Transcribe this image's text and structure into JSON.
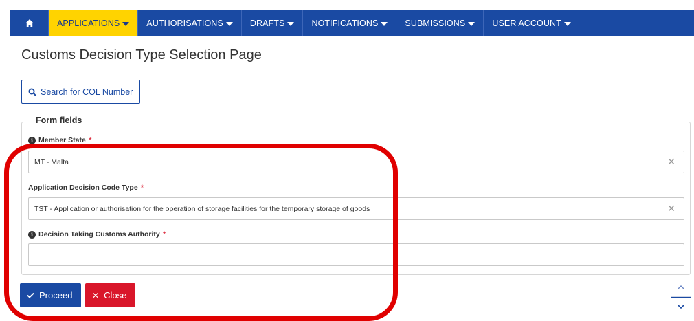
{
  "nav": {
    "home_icon": "home-icon",
    "items": [
      {
        "label": "APPLICATIONS"
      },
      {
        "label": "AUTHORISATIONS"
      },
      {
        "label": "DRAFTS"
      },
      {
        "label": "NOTIFICATIONS"
      },
      {
        "label": "SUBMISSIONS"
      },
      {
        "label": "USER ACCOUNT"
      }
    ],
    "active_color": "#ffd300",
    "bar_color": "#1a4aa3"
  },
  "page": {
    "title": "Customs Decision Type Selection Page"
  },
  "search": {
    "label": "Search for COL Number"
  },
  "form": {
    "legend": "Form fields",
    "member_state": {
      "label": "Member State",
      "required": "*",
      "value": "MT - Malta"
    },
    "decision_code_type": {
      "label": "Application Decision Code Type",
      "required": "*",
      "value": "TST - Application or authorisation for the operation of storage facilities for the temporary storage of goods"
    },
    "customs_authority": {
      "label": "Decision Taking Customs Authority",
      "required": "*",
      "value": ""
    }
  },
  "actions": {
    "proceed_label": "Proceed",
    "close_label": "Close"
  },
  "annotation": {
    "color": "#e00000"
  }
}
